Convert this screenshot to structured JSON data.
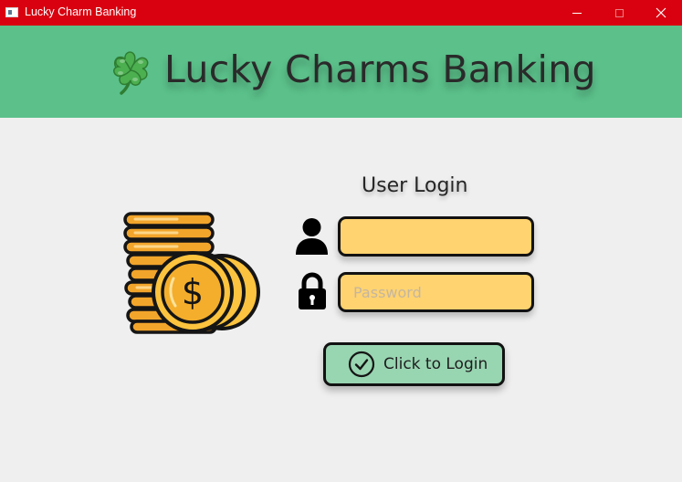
{
  "window": {
    "title": "Lucky Charm Banking",
    "controls": [
      "minimize",
      "maximize",
      "close"
    ]
  },
  "header": {
    "icon": "four-leaf-clover-icon",
    "brand_text": "Lucky Charms Banking",
    "background_color": "#5bc08a"
  },
  "login": {
    "heading": "User Login",
    "username": {
      "icon": "user-icon",
      "value": "",
      "placeholder": ""
    },
    "password": {
      "icon": "lock-icon",
      "value": "",
      "placeholder": "Password"
    },
    "submit": {
      "icon": "checkmark-circle-icon",
      "label": "Click to Login"
    }
  },
  "illustration": {
    "icon": "coin-stack-icon",
    "symbol": "$"
  },
  "colors": {
    "titlebar": "#d9000f",
    "field_fill": "#ffd36f",
    "button_fill": "#98d5b1",
    "page_background": "#efefef"
  }
}
